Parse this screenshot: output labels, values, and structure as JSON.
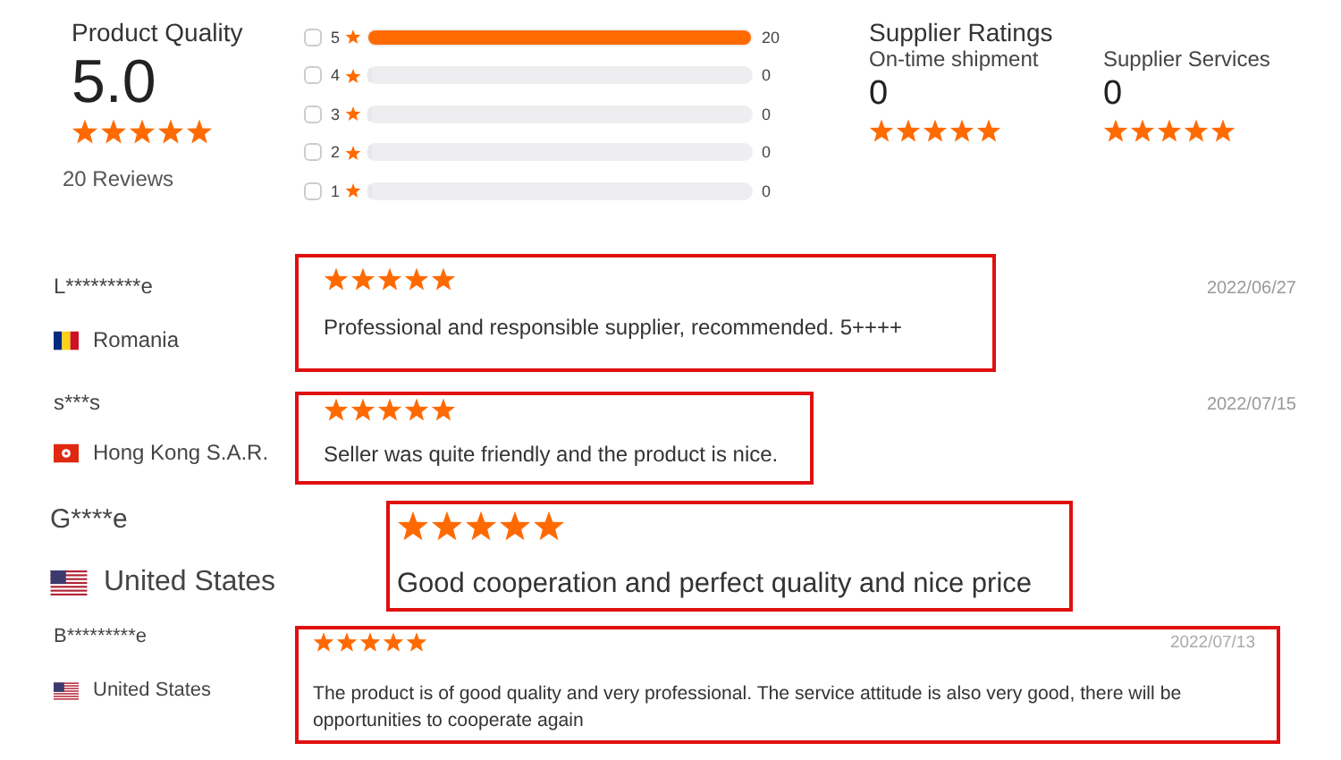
{
  "product_quality": {
    "title": "Product Quality",
    "score": "5.0",
    "stars": 5,
    "reviews": "20 Reviews"
  },
  "breakdown": [
    {
      "checked": false,
      "label": "5",
      "level": 1,
      "count": "20"
    },
    {
      "checked": false,
      "label": "4",
      "level": 0,
      "count": "0"
    },
    {
      "checked": false,
      "label": "3",
      "level": 0,
      "count": "0"
    },
    {
      "checked": false,
      "label": "2",
      "level": 0,
      "count": "0"
    },
    {
      "checked": false,
      "label": "1",
      "level": 0,
      "count": "0"
    }
  ],
  "supplier_ratings": {
    "title": "Supplier Ratings",
    "metrics": [
      {
        "label": "On-time shipment",
        "score": "0",
        "stars": 5
      },
      {
        "label": "Supplier Services",
        "score": "0",
        "stars": 5
      }
    ]
  },
  "reviews": [
    {
      "kind": "normal",
      "name": "L*********e",
      "flag": {
        "kind": "ro"
      },
      "country": "Romania",
      "stars": 5,
      "text": "Professional and responsible supplier, recommended. 5++++",
      "date": "2022/06/27"
    },
    {
      "kind": "compact",
      "name": "s***s",
      "flag": {
        "kind": "hk"
      },
      "country": "Hong Kong S.A.R.",
      "stars": 5,
      "text": "Seller was quite friendly and the product is nice.",
      "date": "2022/07/15"
    },
    {
      "kind": "large",
      "name": "G****e",
      "flag": {
        "kind": "us"
      },
      "country": "United States",
      "stars": 5,
      "text": "Good cooperation and perfect quality and nice price"
    },
    {
      "kind": "wide",
      "name": "B*********e",
      "flag": {
        "kind": "us"
      },
      "country": "United States",
      "stars": 5,
      "text": "The product is of good quality and very professional. The service attitude is also very good, there will be opportunities to cooperate again",
      "date": "2022/07/13"
    }
  ]
}
